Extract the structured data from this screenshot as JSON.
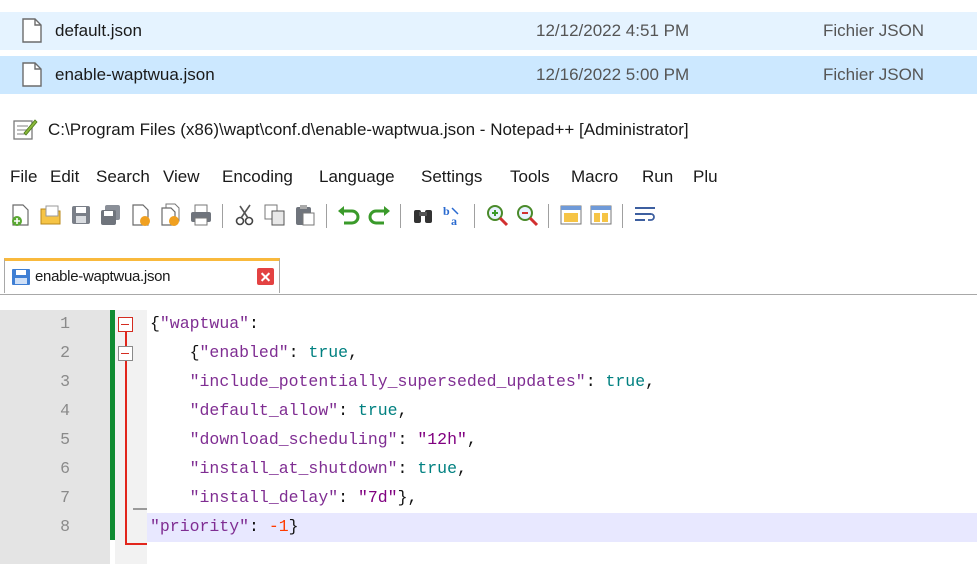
{
  "explorer": {
    "files": [
      {
        "name": "default.json",
        "date": "12/12/2022 4:51 PM",
        "type": "Fichier JSON"
      },
      {
        "name": "enable-waptwua.json",
        "date": "12/16/2022 5:00 PM",
        "type": "Fichier JSON"
      }
    ]
  },
  "window": {
    "title": "C:\\Program Files (x86)\\wapt\\conf.d\\enable-waptwua.json - Notepad++ [Administrator]"
  },
  "menu": [
    "File",
    "Edit",
    "Search",
    "View",
    "Encoding",
    "Language",
    "Settings",
    "Tools",
    "Macro",
    "Run",
    "Plu"
  ],
  "toolbar": {
    "icons": [
      "new-file-icon",
      "open-file-icon",
      "save-icon",
      "save-all-icon",
      "close-icon",
      "close-all-icon",
      "print-icon",
      "cut-icon",
      "copy-icon",
      "paste-icon",
      "undo-icon",
      "redo-icon",
      "find-icon",
      "replace-icon",
      "zoom-in-icon",
      "zoom-out-icon",
      "sync-vertical-icon",
      "sync-horizontal-icon",
      "word-wrap-icon"
    ]
  },
  "tab": {
    "label": "enable-waptwua.json"
  },
  "editor": {
    "lines": [
      {
        "num": "1",
        "tokens": [
          {
            "t": "p",
            "v": "{"
          },
          {
            "t": "k",
            "v": "\"waptwua\""
          },
          {
            "t": "p",
            "v": ":"
          }
        ]
      },
      {
        "num": "2",
        "tokens": [
          {
            "t": "p",
            "v": "    {"
          },
          {
            "t": "k",
            "v": "\"enabled\""
          },
          {
            "t": "p",
            "v": ": "
          },
          {
            "t": "b",
            "v": "true"
          },
          {
            "t": "p",
            "v": ","
          }
        ]
      },
      {
        "num": "3",
        "tokens": [
          {
            "t": "p",
            "v": "    "
          },
          {
            "t": "k",
            "v": "\"include_potentially_superseded_updates\""
          },
          {
            "t": "p",
            "v": ": "
          },
          {
            "t": "b",
            "v": "true"
          },
          {
            "t": "p",
            "v": ","
          }
        ]
      },
      {
        "num": "4",
        "tokens": [
          {
            "t": "p",
            "v": "    "
          },
          {
            "t": "k",
            "v": "\"default_allow\""
          },
          {
            "t": "p",
            "v": ": "
          },
          {
            "t": "b",
            "v": "true"
          },
          {
            "t": "p",
            "v": ","
          }
        ]
      },
      {
        "num": "5",
        "tokens": [
          {
            "t": "p",
            "v": "    "
          },
          {
            "t": "k",
            "v": "\"download_scheduling\""
          },
          {
            "t": "p",
            "v": ": "
          },
          {
            "t": "s",
            "v": "\"12h\""
          },
          {
            "t": "p",
            "v": ","
          }
        ]
      },
      {
        "num": "6",
        "tokens": [
          {
            "t": "p",
            "v": "    "
          },
          {
            "t": "k",
            "v": "\"install_at_shutdown\""
          },
          {
            "t": "p",
            "v": ": "
          },
          {
            "t": "b",
            "v": "true"
          },
          {
            "t": "p",
            "v": ","
          }
        ]
      },
      {
        "num": "7",
        "tokens": [
          {
            "t": "p",
            "v": "    "
          },
          {
            "t": "k",
            "v": "\"install_delay\""
          },
          {
            "t": "p",
            "v": ": "
          },
          {
            "t": "s",
            "v": "\"7d\""
          },
          {
            "t": "p",
            "v": "},"
          }
        ]
      },
      {
        "num": "8",
        "tokens": [
          {
            "t": "k",
            "v": "\"priority\""
          },
          {
            "t": "p",
            "v": ": "
          },
          {
            "t": "n",
            "v": "-1"
          },
          {
            "t": "p",
            "v": "}"
          }
        ]
      }
    ],
    "current_line": 8
  },
  "colors": {
    "tab_accent": "#f9b93c",
    "change_bar": "#108c32",
    "fold_marker": "#e2261c",
    "current_line": "#e8e8ff"
  }
}
